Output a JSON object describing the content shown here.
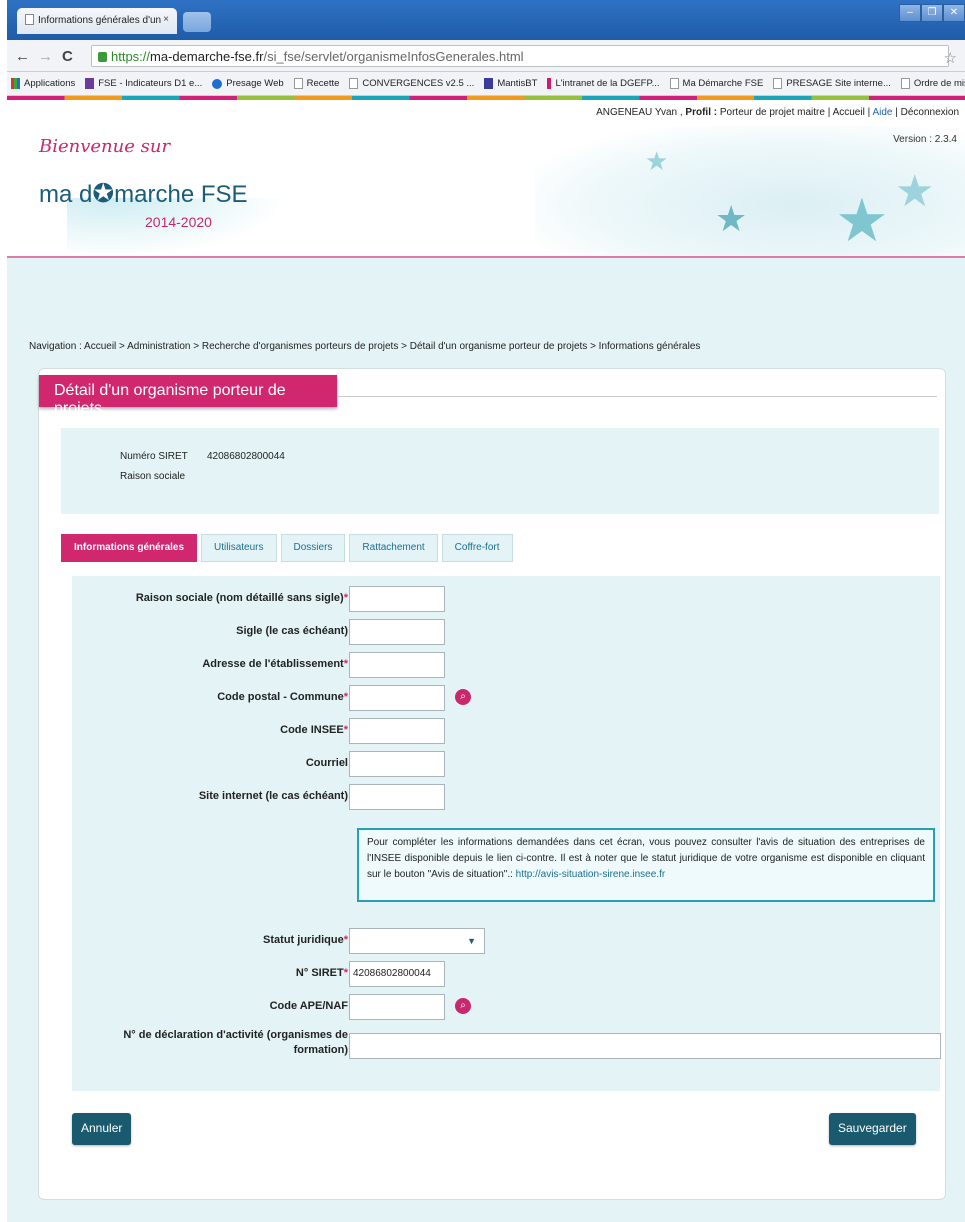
{
  "browser": {
    "tab_title": "Informations générales d'un",
    "tab_close": "×",
    "url": {
      "scheme": "https://",
      "host": "ma-demarche-fse.fr",
      "path": "/si_fse/servlet/organismeInfosGenerales.html"
    },
    "bookmarks": [
      {
        "label": "Applications",
        "icon": "apps-icon"
      },
      {
        "label": "FSE - Indicateurs D1 e...",
        "icon": "fse-icon"
      },
      {
        "label": "Presage Web",
        "icon": "presage-icon"
      },
      {
        "label": "Recette",
        "icon": "page-icon"
      },
      {
        "label": "CONVERGENCES v2.5 ...",
        "icon": "page-icon"
      },
      {
        "label": "MantisBT",
        "icon": "mantis-icon"
      },
      {
        "label": "L'intranet de la DGEFP...",
        "icon": "dgefp-icon"
      },
      {
        "label": "Ma Démarche FSE",
        "icon": "page-icon"
      },
      {
        "label": "PRESAGE Site interne...",
        "icon": "page-icon"
      },
      {
        "label": "Ordre de mission",
        "icon": "page-icon"
      }
    ]
  },
  "topbar": {
    "user": "ANGENEAU Yvan ,",
    "profil_label": "Profil :",
    "profil_value": "Porteur de projet maitre",
    "sep": "|",
    "accueil": "Accueil",
    "aide": "Aide",
    "deconnexion": "Déconnexion"
  },
  "header": {
    "welcome": "Bienvenue sur",
    "brand_left": "ma d",
    "brand_right": "marche FSE",
    "years": "2014-2020",
    "version": "Version : 2.3.4"
  },
  "breadcrumb": "Navigation : Accueil > Administration > Recherche d'organismes porteurs de projets > Détail d'un organisme porteur de projets > Informations générales",
  "card": {
    "title": "Détail d'un organisme porteur de projets",
    "summary": {
      "siret_label": "Numéro SIRET",
      "siret_value": "42086802800044",
      "raison_label": "Raison sociale"
    },
    "tabs": [
      "Informations générales",
      "Utilisateurs",
      "Dossiers",
      "Rattachement",
      "Coffre-fort"
    ],
    "form": {
      "raison_sociale": "Raison sociale (nom détaillé sans sigle)",
      "sigle": "Sigle (le cas échéant)",
      "adresse": "Adresse de l'établissement",
      "code_postal": "Code postal - Commune",
      "code_insee": "Code INSEE",
      "courriel": "Courriel",
      "site_internet": "Site internet (le cas échéant)",
      "required_mark": "*",
      "info_text": "Pour compléter les informations demandées dans cet écran, vous pouvez consulter l'avis de situation des entreprises de l'INSEE disponible depuis le lien ci-contre. Il est à noter que le statut juridique de votre organisme est disponible en cliquant sur le bouton \"Avis de situation\".: ",
      "info_link": "http://avis-situation-sirene.insee.fr",
      "statut_juridique": "Statut juridique",
      "statut_juridique_value": "",
      "siret": "N° SIRET",
      "siret_value": "42086802800044",
      "code_ape": "Code APE/NAF",
      "declaration_line1": "N° de déclaration d'activité (organismes de",
      "declaration_line2": "formation)"
    },
    "buttons": {
      "cancel": "Annuler",
      "save": "Sauvegarder"
    }
  },
  "colors": {
    "brand_pink": "#d0276e",
    "brand_teal": "#1a5a6e",
    "panel_bg": "#e4f4f6",
    "chrome_blue": "#1f5ca8"
  }
}
